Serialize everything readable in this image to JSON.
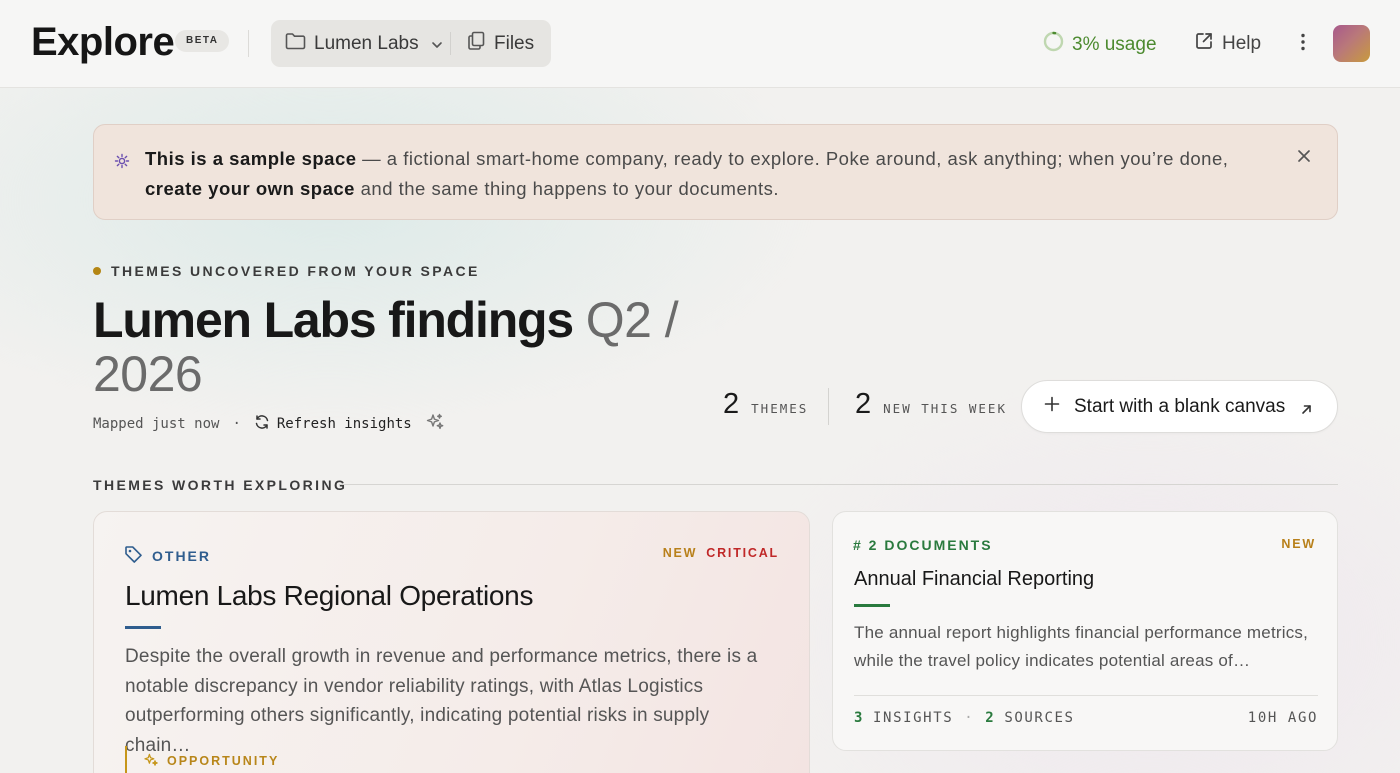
{
  "header": {
    "title": "Explore",
    "badge": "BETA",
    "workspace": "Lumen Labs",
    "files_label": "Files",
    "usage": "3% usage",
    "usage_progress": 0.03,
    "help": "Help"
  },
  "banner": {
    "bold_lead": "This is a sample space",
    "text_mid": " — a fictional smart-home company, ready to explore. Poke around, ask anything; when you’re done, ",
    "bold_cta": "create your own space",
    "text_end": " and the same thing happens to your documents."
  },
  "hero": {
    "eyebrow": "THEMES UNCOVERED FROM YOUR SPACE",
    "title_main": "Lumen Labs findings",
    "title_sub": "Q2 / 2026",
    "mapped": "Mapped just now",
    "meta_sep": "·",
    "refresh": "Refresh insights"
  },
  "stats": {
    "themes_count": "2",
    "themes_label": "THEMES",
    "new_count": "2",
    "new_label": "NEW THIS WEEK"
  },
  "canvas_button": "Start with a blank canvas",
  "section": {
    "label": "THEMES WORTH EXPLORING"
  },
  "cards": [
    {
      "tag": "OTHER",
      "badge_new": "NEW",
      "badge_critical": "CRITICAL",
      "title": "Lumen Labs Regional Operations",
      "description": "Despite the overall growth in revenue and performance metrics, there is a notable discrepancy in vendor reliability ratings, with Atlas Logistics outperforming others significantly, indicating potential risks in supply chain…",
      "insight_type": "OPPORTUNITY"
    },
    {
      "tag": "# 2 DOCUMENTS",
      "badge_new": "NEW",
      "title": "Annual Financial Reporting",
      "description": "The annual report highlights financial performance metrics, while the travel policy indicates potential areas of…",
      "insights_count": "3",
      "insights_label": "INSIGHTS",
      "foot_sep": "·",
      "sources_count": "2",
      "sources_label": "SOURCES",
      "ago": "10H AGO"
    }
  ],
  "colors": {
    "accent_blue": "#2f5d8e",
    "accent_green": "#2a7a3e",
    "new_amber": "#b8801a",
    "critical_red": "#c02828",
    "usage_green": "#4c8a2f"
  }
}
